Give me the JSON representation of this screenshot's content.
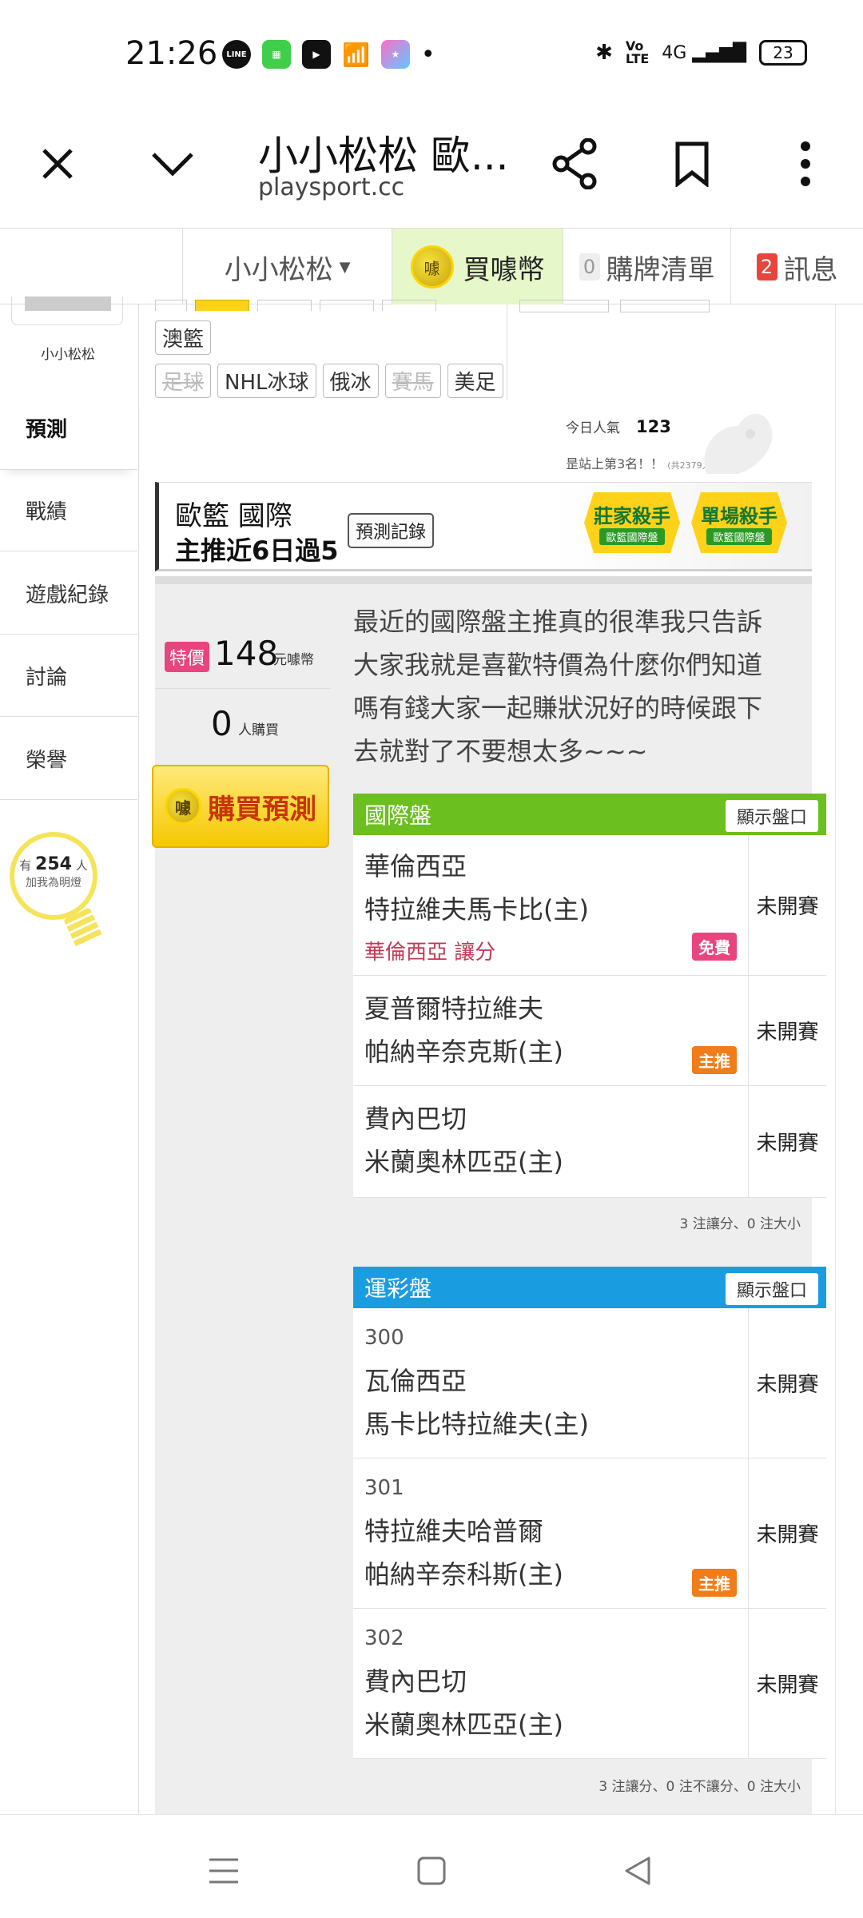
{
  "status_bar": {
    "time": "21:26",
    "battery": "23",
    "net": "4G"
  },
  "browser": {
    "title": "小小松松 歐...",
    "url": "playsport.cc"
  },
  "site_nav": {
    "user_menu": "小小松松",
    "buy_coin": "買噱幣",
    "buy_list_count": "0",
    "buy_list": "購牌清單",
    "messages_count": "2",
    "messages": "訊息"
  },
  "sidebar": {
    "username": "小小松松",
    "items": [
      "預測",
      "戰績",
      "遊戲紀錄",
      "討論",
      "榮譽"
    ],
    "fans_prefix": "有",
    "fans_count": "254",
    "fans_unit": "人",
    "fans_label": "加我為明燈"
  },
  "categories": {
    "row1": [
      "澳籃"
    ],
    "row2": [
      {
        "label": "足球",
        "state": "strike"
      },
      {
        "label": "NHL冰球",
        "state": "normal"
      },
      {
        "label": "俄冰",
        "state": "normal"
      },
      {
        "label": "賽馬",
        "state": "strike"
      },
      {
        "label": "美足",
        "state": "normal"
      }
    ]
  },
  "stats": {
    "today_label": "今日人氣",
    "today_value": "123",
    "rank_text": "昰站上第3名！！",
    "rank_note": "(共2379人)"
  },
  "predict": {
    "title": "歐籃 國際",
    "subtitle": "主推近6日過5",
    "record_button": "預測記錄",
    "badge1_title": "莊家殺手",
    "badge1_sub": "歐籃國際盤",
    "badge2_title": "單場殺手",
    "badge2_sub": "歐籃國際盤",
    "price_tag": "特價",
    "price": "148",
    "price_unit": "元噱幣",
    "buyers": "0",
    "buyers_unit": "人購買",
    "buy_button": "購買預測",
    "description": "最近的國際盤主推真的很準我只告訴大家我就是喜歡特價為什麼你們知道嗎有錢大家一起賺狀況好的時候跟下去就對了不要想太多~~~"
  },
  "intl_group": {
    "title": "國際盤",
    "show_button": "顯示盤口",
    "games": [
      {
        "away": "華倫西亞",
        "home": "特拉維夫馬卡比(主)",
        "pick": "華倫西亞 讓分",
        "tag": "免費",
        "status": "未開賽"
      },
      {
        "away": "夏普爾特拉維夫",
        "home": "帕納辛奈克斯(主)",
        "tag": "主推",
        "status": "未開賽"
      },
      {
        "away": "費內巴切",
        "home": "米蘭奧林匹亞(主)",
        "status": "未開賽"
      }
    ],
    "summary": "3 注讓分、0 注大小"
  },
  "lottery_group": {
    "title": "運彩盤",
    "show_button": "顯示盤口",
    "games": [
      {
        "num": "300",
        "away": "瓦倫西亞",
        "home": "馬卡比特拉維夫(主)",
        "status": "未開賽"
      },
      {
        "num": "301",
        "away": "特拉維夫哈普爾",
        "home": "帕納辛奈科斯(主)",
        "tag": "主推",
        "status": "未開賽"
      },
      {
        "num": "302",
        "away": "費內巴切",
        "home": "米蘭奧林匹亞(主)",
        "status": "未開賽"
      }
    ],
    "summary": "3 注讓分、0 注不讓分、0 注大小"
  },
  "colors": {
    "intl_header": "#6bbf1e",
    "lottery_header": "#1a9de0",
    "free_tag": "#e8457e",
    "main_tag": "#f07c1a",
    "pick_text": "#c23b55"
  }
}
